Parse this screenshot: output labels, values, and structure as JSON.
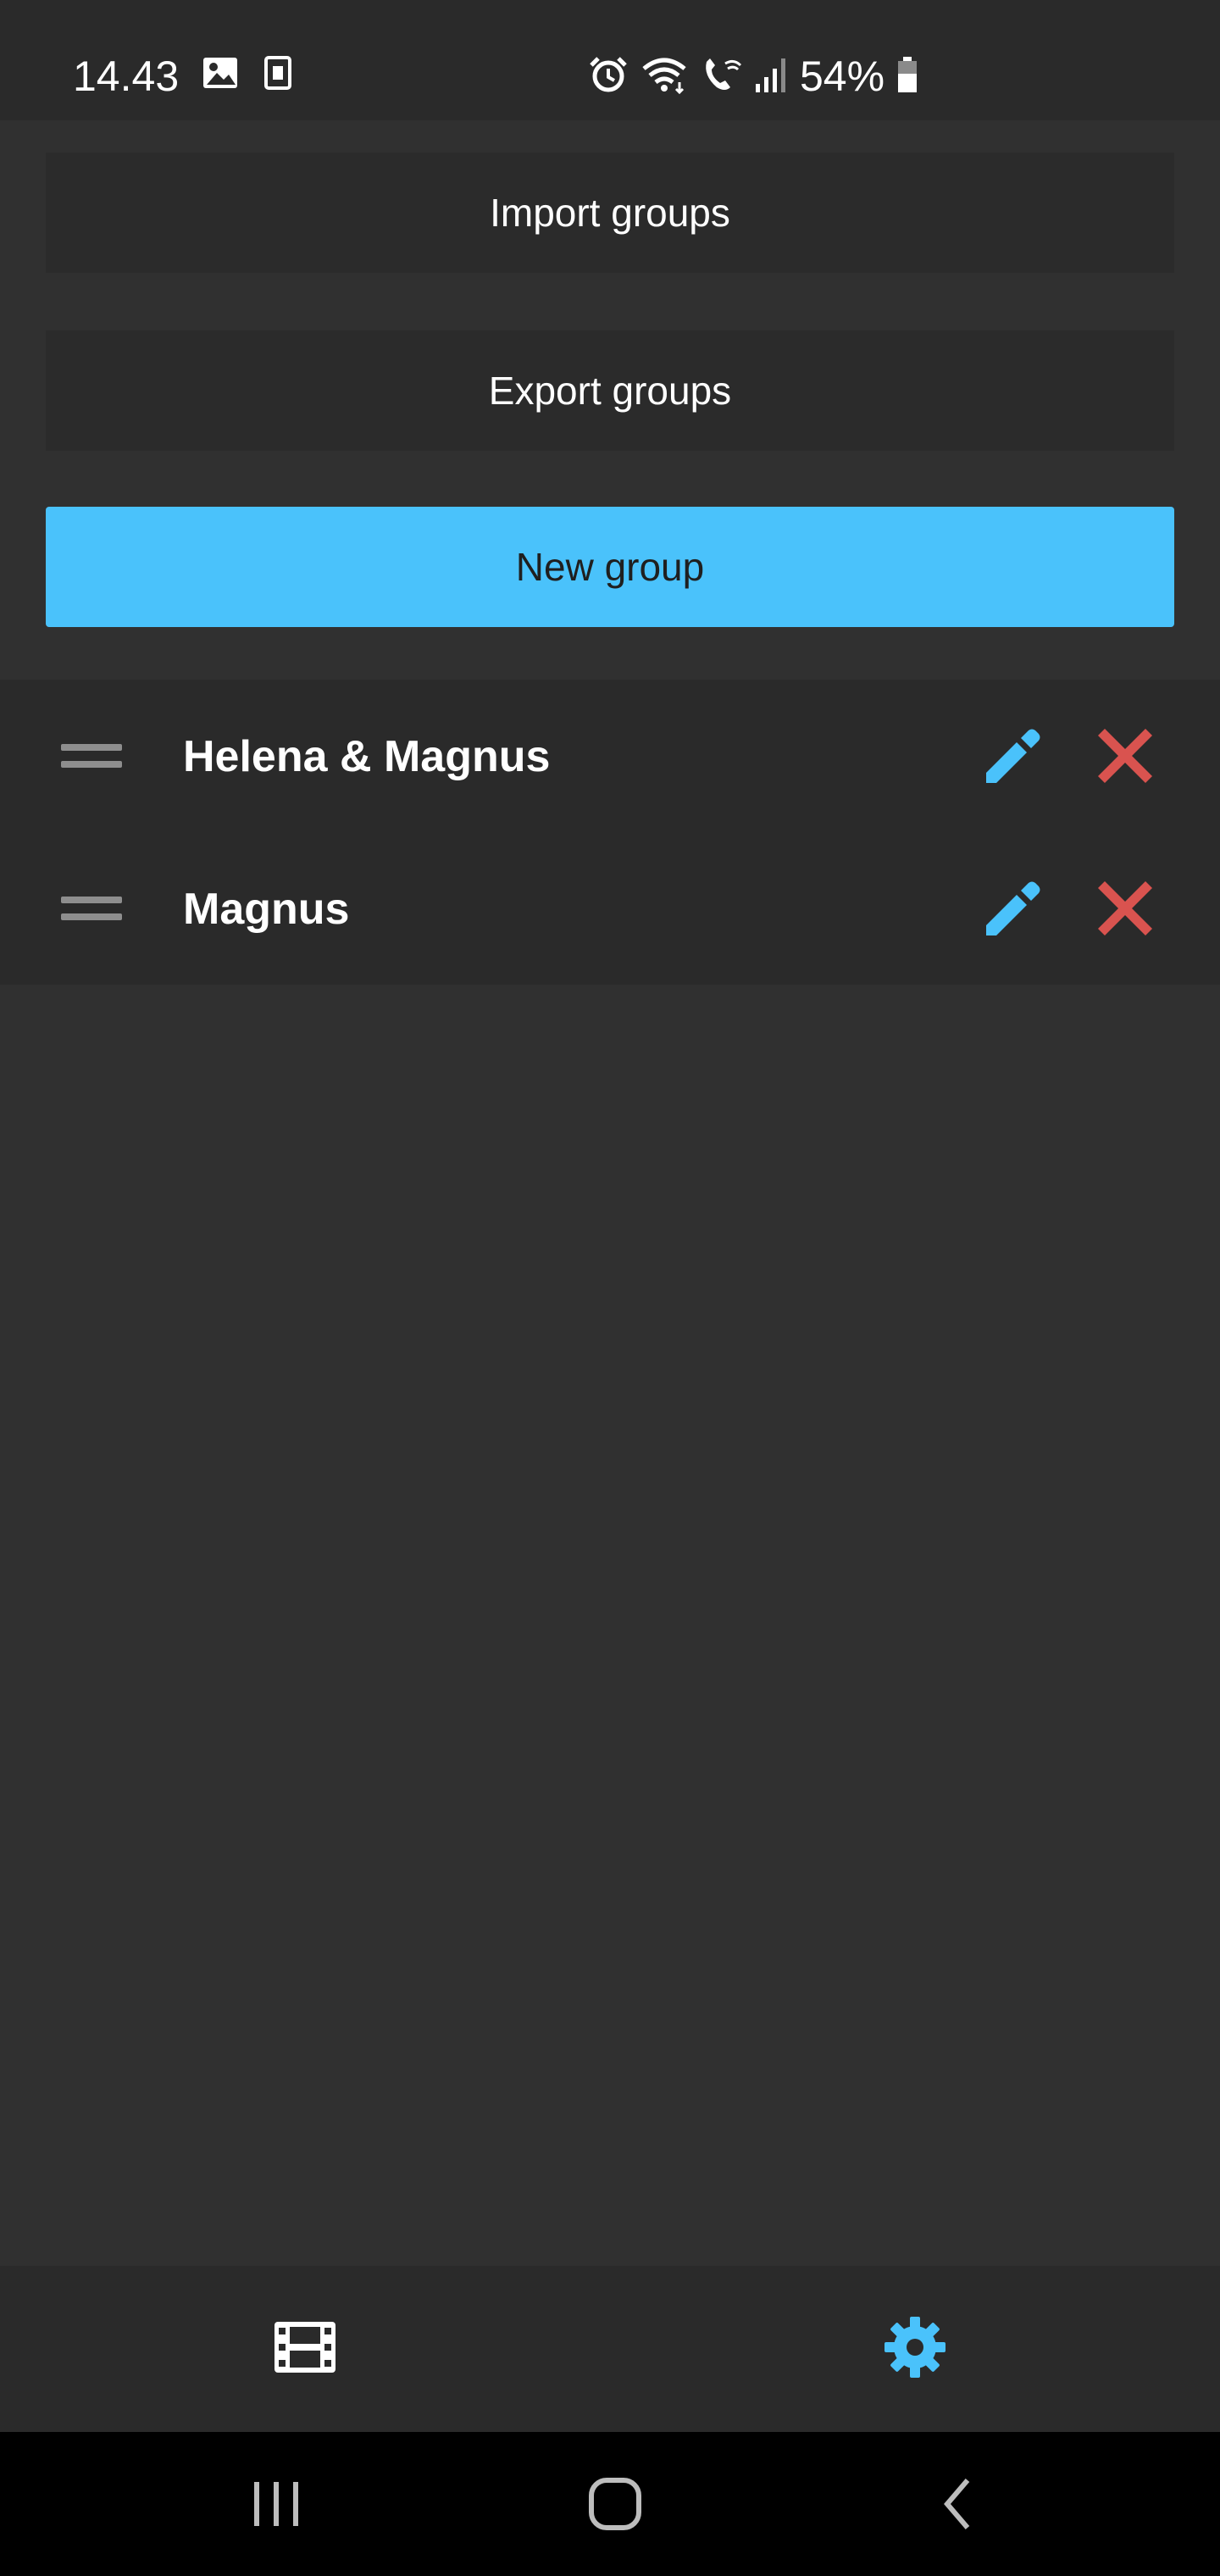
{
  "status_bar": {
    "time": "14.43",
    "battery": "54%",
    "icons": [
      "gallery-icon",
      "sim-icon",
      "alarm-icon",
      "wifi-icon",
      "wifi-calling-icon",
      "signal-icon",
      "battery-icon"
    ]
  },
  "actions": {
    "import_label": "Import groups",
    "export_label": "Export groups",
    "new_group_label": "New group"
  },
  "groups": [
    {
      "name": "Helena & Magnus"
    },
    {
      "name": "Magnus"
    }
  ],
  "bottom_nav": {
    "items": [
      {
        "icon": "film-icon",
        "active": false
      },
      {
        "icon": "gear-icon",
        "active": true
      }
    ]
  },
  "colors": {
    "accent": "#4ac2fb",
    "delete": "#d9534f",
    "background": "#303030",
    "surface": "#2a2a2a"
  }
}
